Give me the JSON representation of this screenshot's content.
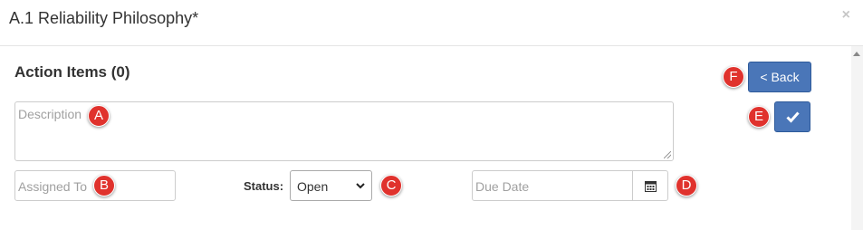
{
  "modal": {
    "title": "A.1 Reliability Philosophy*",
    "close_label": "×"
  },
  "section": {
    "title": "Action Items (0)"
  },
  "form": {
    "description_placeholder": "Description",
    "assigned_to_placeholder": "Assigned To",
    "status_label": "Status:",
    "status_value": "Open",
    "due_date_placeholder": "Due Date"
  },
  "buttons": {
    "back_label": "< Back"
  },
  "markers": {
    "a": "A",
    "b": "B",
    "c": "C",
    "d": "D",
    "e": "E",
    "f": "F"
  },
  "colors": {
    "primary_button": "#4a76b8",
    "marker": "#e0322d"
  },
  "icons": {
    "calendar": "calendar-icon",
    "check": "check-icon",
    "close": "close-icon"
  }
}
